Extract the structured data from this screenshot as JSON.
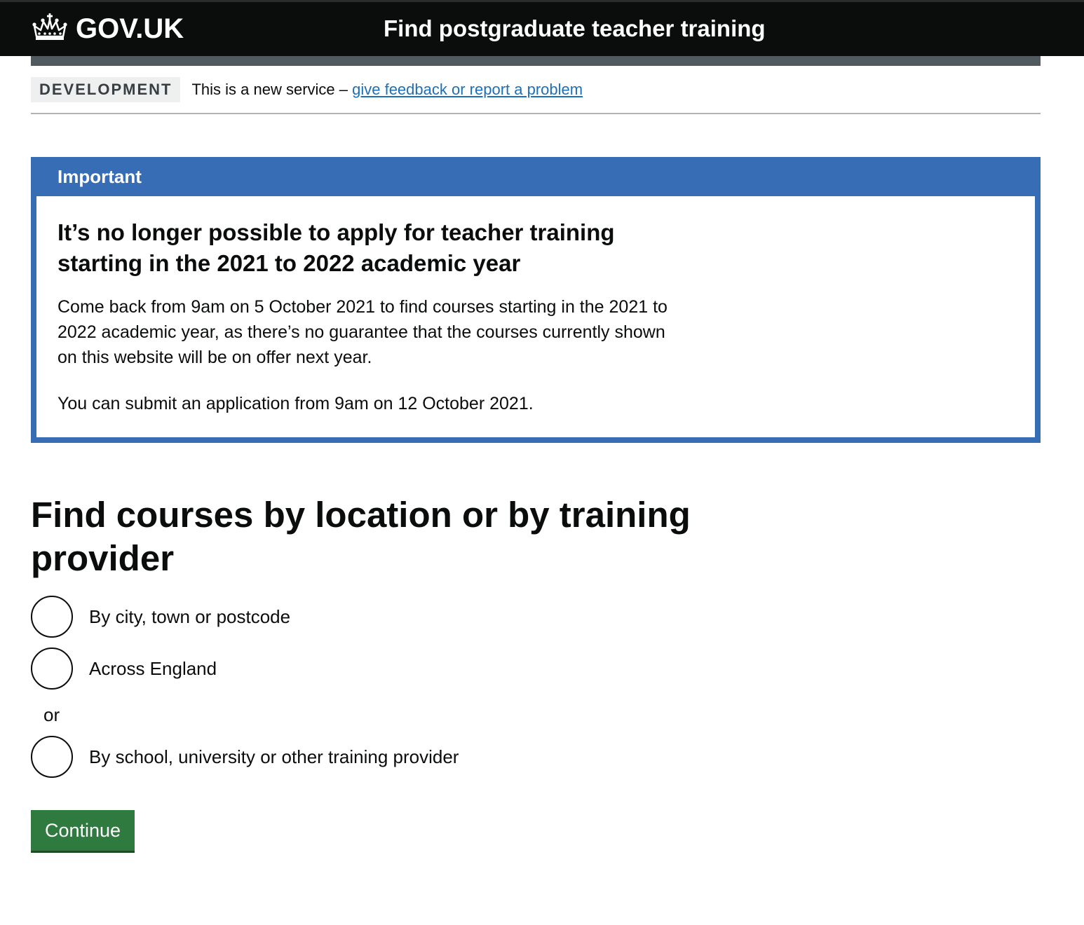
{
  "header": {
    "logo_text": "GOV.UK",
    "service_name": "Find postgraduate teacher training",
    "logo_icon": "crown-icon"
  },
  "phase_banner": {
    "tag": "DEVELOPMENT",
    "text": "This is a new service – ",
    "link_text": "give feedback or report a problem"
  },
  "notification": {
    "title": "Important",
    "heading": "It’s no longer possible to apply for teacher training starting in the 2021 to 2022 academic year",
    "para1": "Come back from 9am on 5 October 2021 to find courses starting in the 2021 to 2022 academic year, as there’s no guarantee that the courses currently shown on this website will be on offer next year.",
    "para2": "You can submit an application from 9am on 12 October 2021."
  },
  "form": {
    "heading": "Find courses by location or by training provider",
    "options": [
      {
        "label": "By city, town or postcode",
        "selected": false
      },
      {
        "label": "Across England",
        "selected": false
      },
      {
        "label": "By school, university or other training provider",
        "selected": false
      }
    ],
    "divider": "or",
    "continue_label": "Continue"
  },
  "colors": {
    "header_bg": "#0b0c0c",
    "banner_blue": "#366db5",
    "link_blue": "#1d70b8",
    "button_green": "#2f7a3f",
    "grey_bar": "#505a5f"
  }
}
